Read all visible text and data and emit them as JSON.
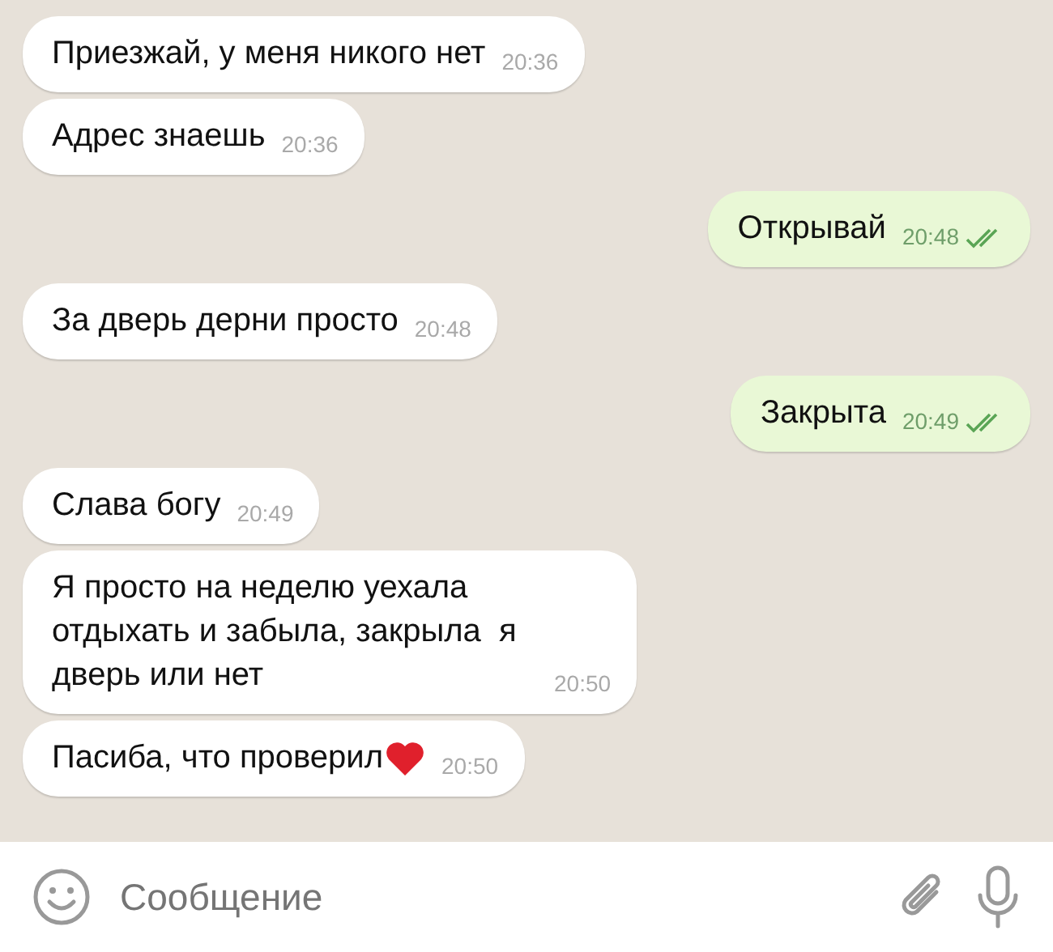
{
  "messages": [
    {
      "kind": "incoming",
      "text": "Приезжай, у меня никого нет",
      "time": "20:36"
    },
    {
      "kind": "incoming",
      "text": "Адрес знаешь",
      "time": "20:36"
    },
    {
      "kind": "outgoing",
      "text": "Открывай",
      "time": "20:48",
      "double_tick": true
    },
    {
      "kind": "incoming",
      "text": "За дверь дерни просто",
      "time": "20:48"
    },
    {
      "kind": "outgoing",
      "text": "Закрыта",
      "time": "20:49",
      "double_tick": true
    },
    {
      "kind": "incoming",
      "text": "Слава богу",
      "time": "20:49"
    },
    {
      "kind": "incoming",
      "text": "Я просто на неделю уехала отдыхать и забыла, закрыла  я дверь или нет",
      "time": "20:50"
    },
    {
      "kind": "incoming",
      "text": "Пасиба, что проверил",
      "time": "20:50",
      "heart": true
    }
  ],
  "composer": {
    "placeholder": "Сообщение"
  }
}
